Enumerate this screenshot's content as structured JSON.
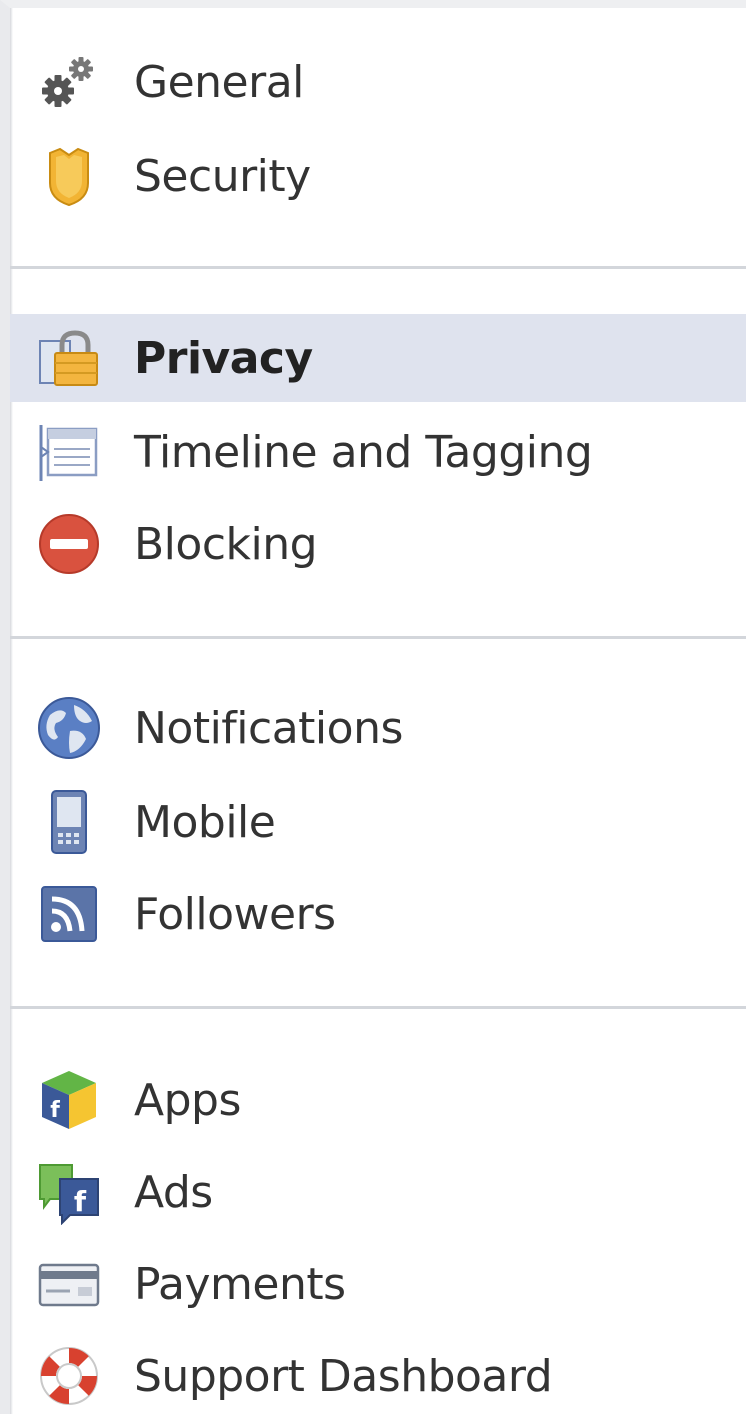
{
  "sections": [
    {
      "items": [
        {
          "key": "general",
          "label": "General",
          "icon": "gears-icon",
          "selected": false
        },
        {
          "key": "security",
          "label": "Security",
          "icon": "badge-icon",
          "selected": false
        }
      ]
    },
    {
      "items": [
        {
          "key": "privacy",
          "label": "Privacy",
          "icon": "lock-icon",
          "selected": true
        },
        {
          "key": "timeline",
          "label": "Timeline and Tagging",
          "icon": "timeline-icon",
          "selected": false
        },
        {
          "key": "blocking",
          "label": "Blocking",
          "icon": "block-icon",
          "selected": false
        }
      ]
    },
    {
      "items": [
        {
          "key": "notifications",
          "label": "Notifications",
          "icon": "globe-icon",
          "selected": false
        },
        {
          "key": "mobile",
          "label": "Mobile",
          "icon": "phone-icon",
          "selected": false
        },
        {
          "key": "followers",
          "label": "Followers",
          "icon": "rss-icon",
          "selected": false
        }
      ]
    },
    {
      "items": [
        {
          "key": "apps",
          "label": "Apps",
          "icon": "apps-cube-icon",
          "selected": false
        },
        {
          "key": "ads",
          "label": "Ads",
          "icon": "ads-icon",
          "selected": false
        },
        {
          "key": "payments",
          "label": "Payments",
          "icon": "credit-card-icon",
          "selected": false
        },
        {
          "key": "support",
          "label": "Support Dashboard",
          "icon": "lifebuoy-icon",
          "selected": false
        }
      ]
    }
  ],
  "colors": {
    "selected_bg": "#dfe3ee",
    "divider": "#d3d6db",
    "text": "#333333"
  }
}
